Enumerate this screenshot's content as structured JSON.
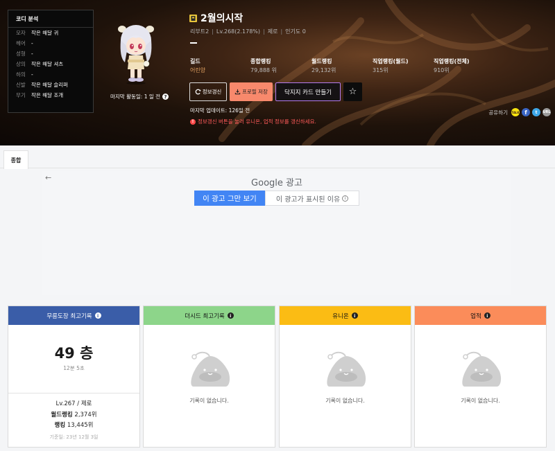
{
  "coordi": {
    "title": "코디 분석",
    "items": [
      {
        "slot": "모자",
        "item": "작은 해달 귀"
      },
      {
        "slot": "헤어",
        "item": "-"
      },
      {
        "slot": "성형",
        "item": "-"
      },
      {
        "slot": "상의",
        "item": "작은 해달 셔츠"
      },
      {
        "slot": "하의",
        "item": "-"
      },
      {
        "slot": "신발",
        "item": "작은 해달 슬리퍼"
      },
      {
        "slot": "무기",
        "item": "작은 해달 조개"
      }
    ]
  },
  "character": {
    "last_active": "마지막 활동일: 1 일 전",
    "name": "2월의시작",
    "world": "리부트2",
    "level": "Lv.268(2.178%)",
    "job": "제로",
    "popularity": "인기도 0",
    "dash": "—"
  },
  "ranks": [
    {
      "label": "길드",
      "value": "어린양"
    },
    {
      "label": "종합랭킹",
      "value": "79,888 위"
    },
    {
      "label": "월드랭킹",
      "value": "29,132위"
    },
    {
      "label": "직업랭킹(월드)",
      "value": "315위"
    },
    {
      "label": "직업랭킹(전체)",
      "value": "910위"
    }
  ],
  "buttons": {
    "refresh": "정보갱신",
    "save": "프로필 저장",
    "card": "닥지지 카드 만들기"
  },
  "update_text": "마지막 업데이트: 126일 전",
  "notice_text": "정보갱신 버튼을 눌러 유니온, 업적 정보를 갱신하세요.",
  "share": {
    "label": "공유하기",
    "kakao": "TALK",
    "facebook": "f",
    "twitter": "t",
    "url": "URL"
  },
  "tabs": [
    {
      "label": "종합"
    }
  ],
  "ad": {
    "back": "←",
    "title": "Google 광고",
    "stop": "이 광고 그만 보기",
    "why": "이 광고가 표시된 이유",
    "why_icon": "i"
  },
  "cards": {
    "mureung": {
      "title": "무릉도장 최고기록",
      "floor": "49 층",
      "time": "12분 5초",
      "level_job": "Lv.267 / 제로",
      "world_rank_label": "월드랭킹",
      "world_rank": "2,374위",
      "rank_label": "랭킹",
      "rank": "13,445위",
      "base_date": "기준일: 23년 12월 3일"
    },
    "theseed": {
      "title": "더시드 최고기록",
      "empty": "기록이 없습니다."
    },
    "union": {
      "title": "유니온",
      "empty": "기록이 없습니다."
    },
    "achievement": {
      "title": "업적",
      "empty": "기록이 없습니다."
    }
  },
  "icons": {
    "question": "?",
    "info": "i",
    "exclamation": "!",
    "star": "☆"
  },
  "colors": {
    "mureung": "#3a5da8",
    "theseed": "#8dd58a",
    "union": "#fbbc14",
    "achievement": "#fb8c5a",
    "save_button": "#f8896c",
    "ad_blue": "#4285f4",
    "notice_red": "#ff5a5a"
  }
}
